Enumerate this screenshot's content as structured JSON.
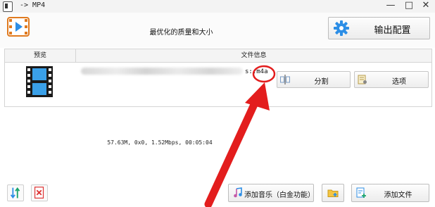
{
  "window": {
    "title": "-> MP4",
    "minimize": "—",
    "maximize": "□",
    "close": "✕"
  },
  "header": {
    "subtitle": "最优化的质量和大小",
    "settings_label": "输出配置"
  },
  "table": {
    "col_preview": "预览",
    "col_info": "文件信息",
    "row": {
      "file_ext": "s:.m4a",
      "meta": "57.63M, 0x0, 1.52Mbps, 00:05:04"
    }
  },
  "row_actions": {
    "split_label": "分割",
    "options_label": "选项"
  },
  "footer": {
    "add_music_label": "添加音乐（白金功能）",
    "add_file_label": "添加文件"
  },
  "colors": {
    "accent": "#2c8ee6",
    "annotation": "#e31d1d"
  }
}
